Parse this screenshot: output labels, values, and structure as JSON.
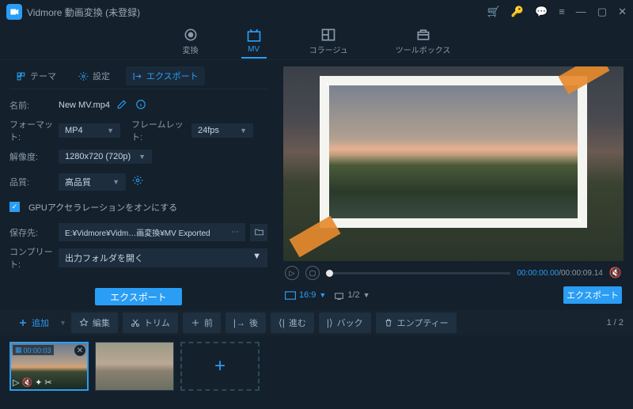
{
  "titlebar": {
    "title": "Vidmore 動画変換 (未登録)"
  },
  "modes": {
    "convert": "変換",
    "mv": "MV",
    "collage": "コラージュ",
    "toolbox": "ツールボックス"
  },
  "subtabs": {
    "theme": "テーマ",
    "settings": "設定",
    "export": "エクスポート"
  },
  "form": {
    "name_lbl": "名前:",
    "name_val": "New MV.mp4",
    "format_lbl": "フォーマット:",
    "format_val": "MP4",
    "frame_lbl": "フレームレット:",
    "frame_val": "24fps",
    "res_lbl": "解像度:",
    "res_val": "1280x720 (720p)",
    "quality_lbl": "品質:",
    "quality_val": "高品質",
    "gpu_lbl": "GPUアクセラレーションをオンにする",
    "savepath_lbl": "保存先:",
    "savepath_val": "E:¥Vidmore¥Vidm…画変換¥MV Exported",
    "complete_lbl": "コンプリート:",
    "complete_val": "出力フォルダを開く",
    "export_btn": "エクスポート"
  },
  "player": {
    "time_current": "00:00:00.00",
    "time_total": "00:00:09.14",
    "aspect": "16:9",
    "page": "1/2"
  },
  "export_right": "エクスポート",
  "toolbar": {
    "add": "追加",
    "edit": "編集",
    "trim": "トリム",
    "front": "前",
    "back": "後",
    "forward": "進む",
    "backward": "バック",
    "empty": "エンプティー",
    "page": "1 / 2"
  },
  "timeline": {
    "thumb1_dur": "00:00:03"
  }
}
